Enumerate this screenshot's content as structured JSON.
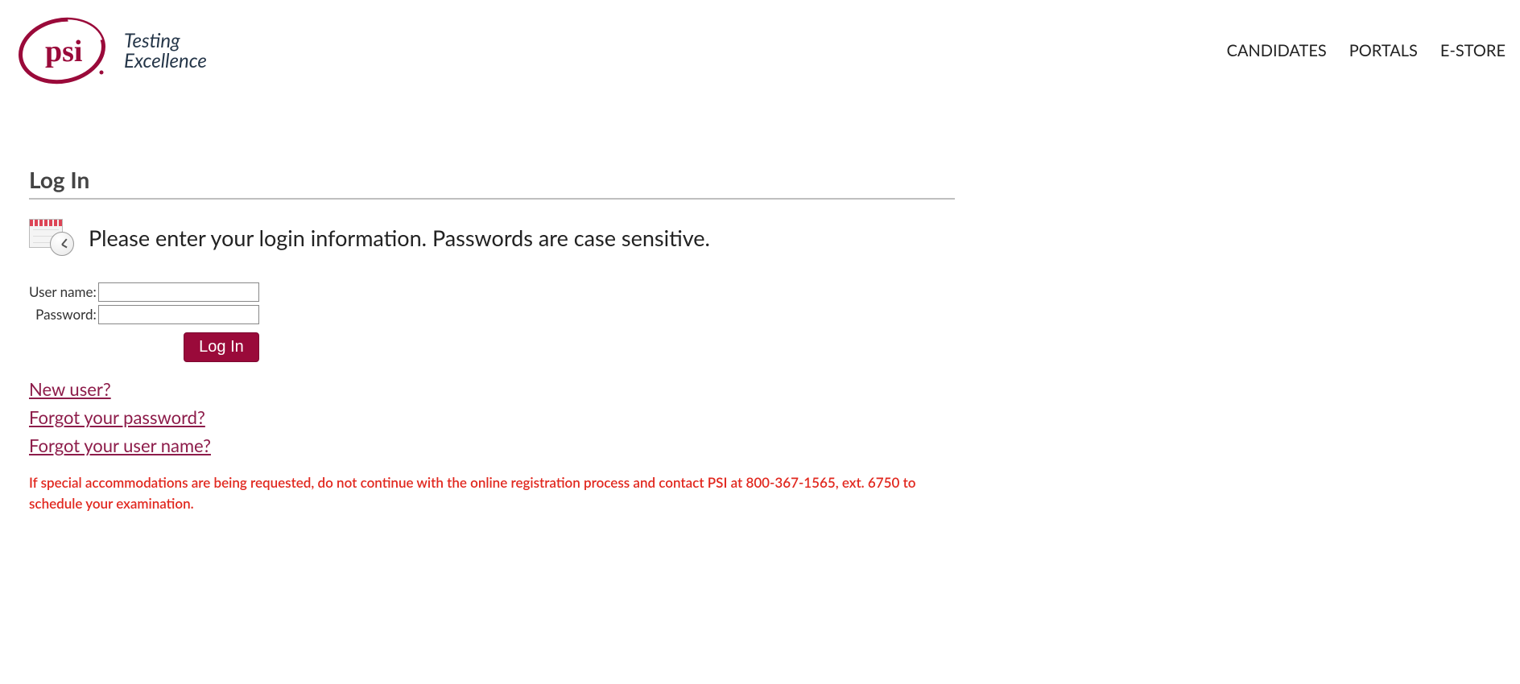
{
  "header": {
    "logo_tagline_line1": "Testing",
    "logo_tagline_line2": "Excellence",
    "nav": {
      "candidates": "CANDIDATES",
      "portals": "PORTALS",
      "estore": "E-STORE"
    }
  },
  "login": {
    "title": "Log In",
    "instruction": "Please enter your login information. Passwords are case sensitive.",
    "username_label": "User name:",
    "password_label": "Password:",
    "username_value": "",
    "password_value": "",
    "submit_label": "Log In"
  },
  "links": {
    "new_user": "New user?",
    "forgot_password": "Forgot your password?",
    "forgot_username": "Forgot your user name?"
  },
  "notice": "If special accommodations are being requested, do not continue with the online registration process and contact PSI at 800-367-1565, ext. 6750 to schedule your examination.",
  "colors": {
    "brand_maroon": "#9a0a3a",
    "link_maroon": "#8d1c4a",
    "alert_red": "#e1281f"
  }
}
